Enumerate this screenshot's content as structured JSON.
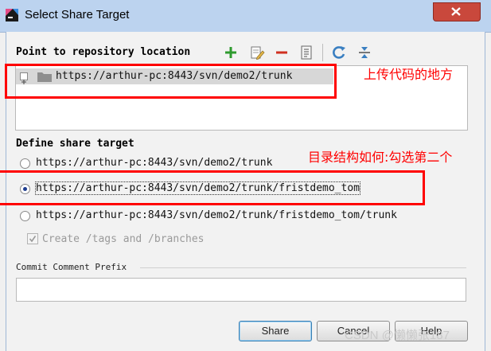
{
  "window": {
    "title": "Select Share Target",
    "close_icon": "close-icon"
  },
  "repository": {
    "label": "Point to repository location",
    "toolbar": [
      "add-icon",
      "edit-icon",
      "remove-icon",
      "details-icon",
      "refresh-icon",
      "collapse-icon"
    ],
    "items": [
      {
        "url": "https://arthur-pc:8443/svn/demo2/trunk",
        "icon": "folder-icon"
      }
    ]
  },
  "share_target": {
    "label": "Define share target",
    "options": [
      {
        "label": "https://arthur-pc:8443/svn/demo2/trunk",
        "selected": false
      },
      {
        "label": "https://arthur-pc:8443/svn/demo2/trunk/fristdemo_tom",
        "selected": true
      },
      {
        "label": "https://arthur-pc:8443/svn/demo2/trunk/fristdemo_tom/trunk",
        "selected": false
      }
    ],
    "create_tags": {
      "label": "Create /tags and /branches",
      "checked": true,
      "disabled": true
    }
  },
  "commit": {
    "label": "Commit Comment Prefix",
    "value": ""
  },
  "buttons": {
    "share": "Share",
    "cancel": "Cancel",
    "help": "Help"
  },
  "annotations": {
    "upload_location": "上传代码的地方",
    "structure_note": "目录结构如何:勾选第二个"
  },
  "watermark": "CSDN @懒懒张187",
  "colors": {
    "annotation": "#ff0000",
    "title_bar": "#bcd3ef",
    "close_button": "#c9483c",
    "add_icon": "#2e9a2e",
    "remove_icon": "#d03020",
    "refresh_icon": "#3a7fc1"
  }
}
